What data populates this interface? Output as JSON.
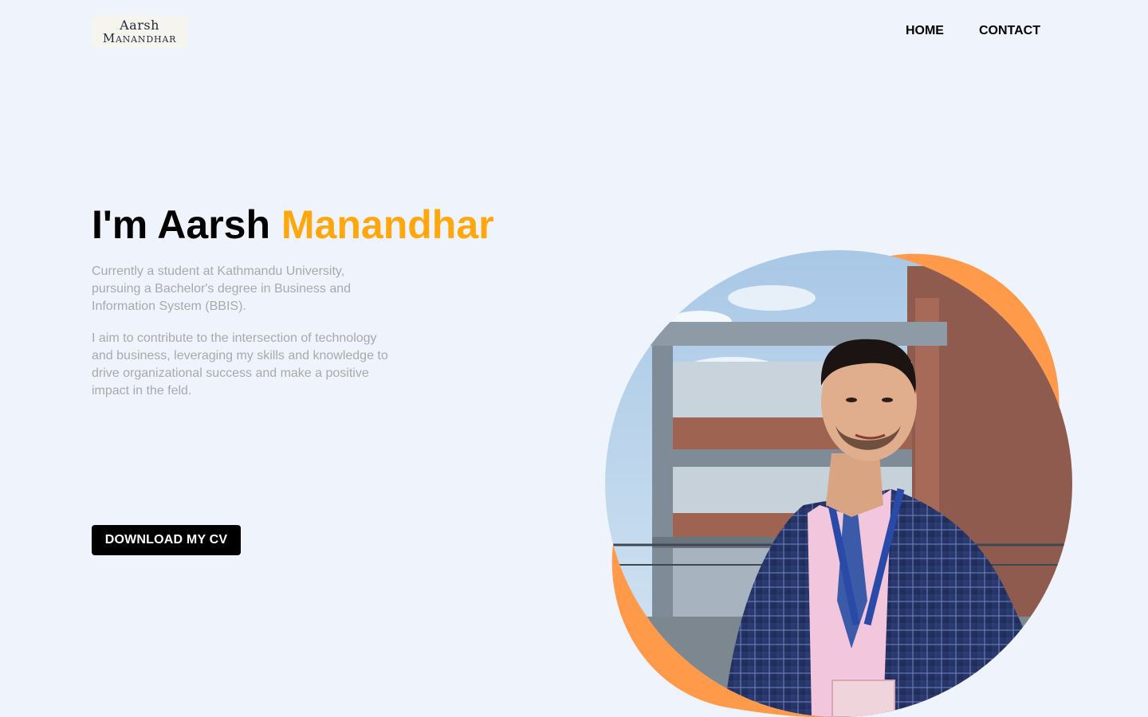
{
  "brand": {
    "logo_line1": "Aarsh",
    "logo_line2": "Manandhar"
  },
  "nav": {
    "items": [
      {
        "label": "HOME"
      },
      {
        "label": "CONTACT"
      }
    ]
  },
  "hero": {
    "title_prefix": "I'm Aarsh ",
    "title_accent": "Manandhar",
    "paragraph1": "Currently a student at Kathmandu University, pursuing a Bachelor's degree in Business and Information System (BBIS).",
    "paragraph2": "I aim to contribute to the intersection of technology and business, leveraging my skills and knowledge to drive organizational success and make a positive impact in the feld.",
    "cta_label": "DOWNLOAD MY CV"
  },
  "colors": {
    "background": "#eff4fc",
    "accent": "#ffa70c",
    "blob": "#ff9a4a",
    "text_muted": "#a9a9ab",
    "button_bg": "#000000"
  }
}
